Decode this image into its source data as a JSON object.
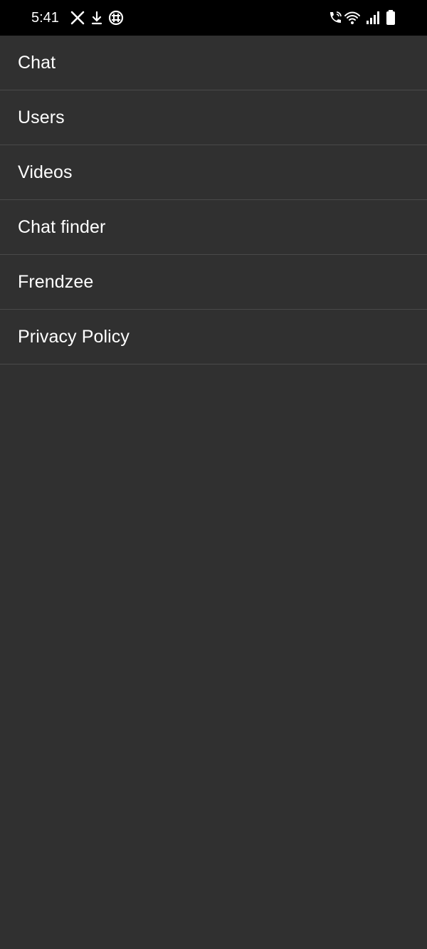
{
  "status_bar": {
    "time": "5:41",
    "left_icons": [
      "x-logo-icon",
      "download-icon",
      "grid-app-icon"
    ],
    "right_icons": [
      "wifi-calling-icon",
      "wifi-icon",
      "signal-icon",
      "battery-icon"
    ]
  },
  "menu": {
    "items": [
      {
        "label": "Chat"
      },
      {
        "label": "Users"
      },
      {
        "label": "Videos"
      },
      {
        "label": "Chat finder"
      },
      {
        "label": "Frendzee"
      },
      {
        "label": "Privacy Policy"
      }
    ]
  },
  "colors": {
    "background": "#303030",
    "status_bar": "#000000",
    "divider": "#4a4a4a",
    "text": "#ffffff"
  }
}
